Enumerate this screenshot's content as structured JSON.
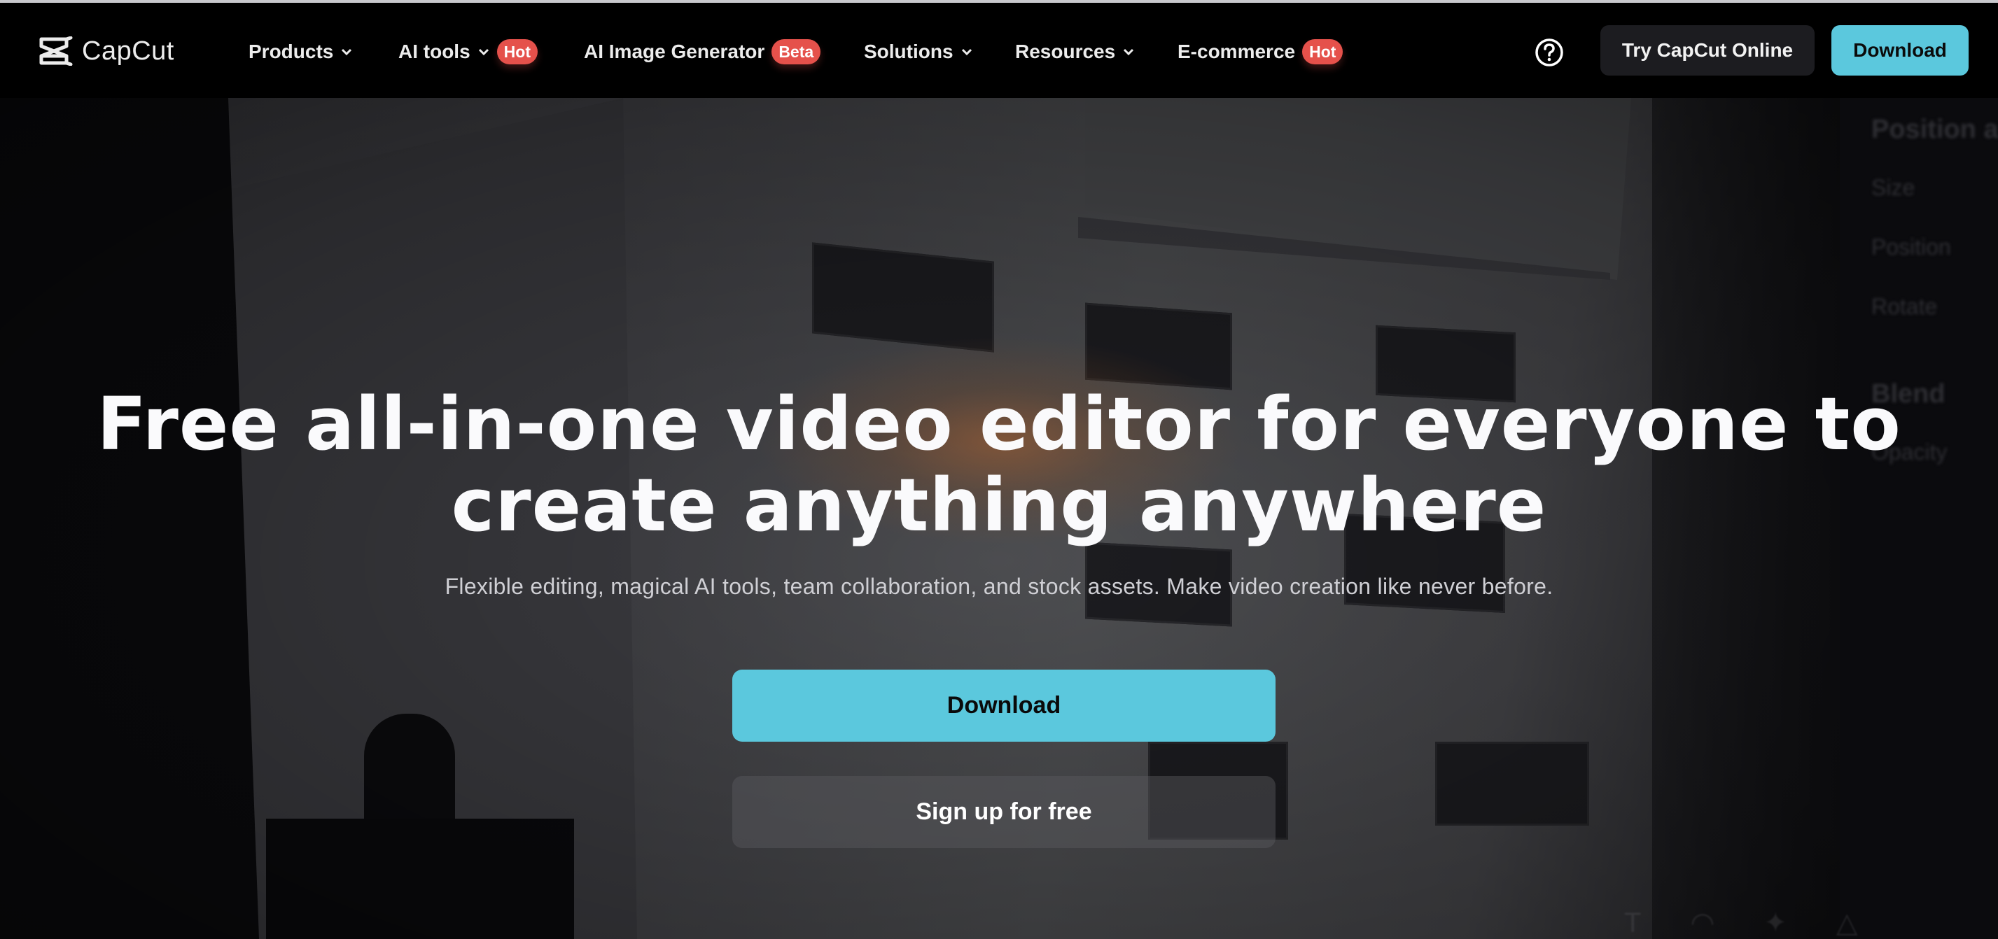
{
  "brand": {
    "name": "CapCut",
    "logo_icon": "capcut-logo-icon"
  },
  "nav": {
    "items": [
      {
        "label": "Products",
        "has_dropdown": true,
        "badge": null
      },
      {
        "label": "AI tools",
        "has_dropdown": true,
        "badge": "Hot"
      },
      {
        "label": "AI Image Generator",
        "has_dropdown": false,
        "badge": "Beta"
      },
      {
        "label": "Solutions",
        "has_dropdown": true,
        "badge": null
      },
      {
        "label": "Resources",
        "has_dropdown": true,
        "badge": null
      },
      {
        "label": "E-commerce",
        "has_dropdown": false,
        "badge": "Hot"
      }
    ],
    "help_icon": "question-circle-icon",
    "try_online_label": "Try CapCut Online",
    "download_label": "Download"
  },
  "hero": {
    "headline_line1": "Free all-in-one video editor for everyone to",
    "headline_line2": "create anything anywhere",
    "subtitle": "Flexible editing, magical AI tools, team collaboration, and stock assets. Make video creation like never before.",
    "primary_cta": "Download",
    "secondary_cta": "Sign up for free"
  },
  "background_editor_panel": {
    "labels": [
      "Position a",
      "Size",
      "Position",
      "Rotate",
      "Blend",
      "Opacity"
    ],
    "toolbar_icons": [
      "text-icon",
      "sticker-icon",
      "effects-icon",
      "filter-icon"
    ]
  },
  "colors": {
    "accent": "#5bc8dd",
    "badge": "#e5514b",
    "nav_bg": "#000000",
    "secondary_button": "#1c1c20"
  }
}
